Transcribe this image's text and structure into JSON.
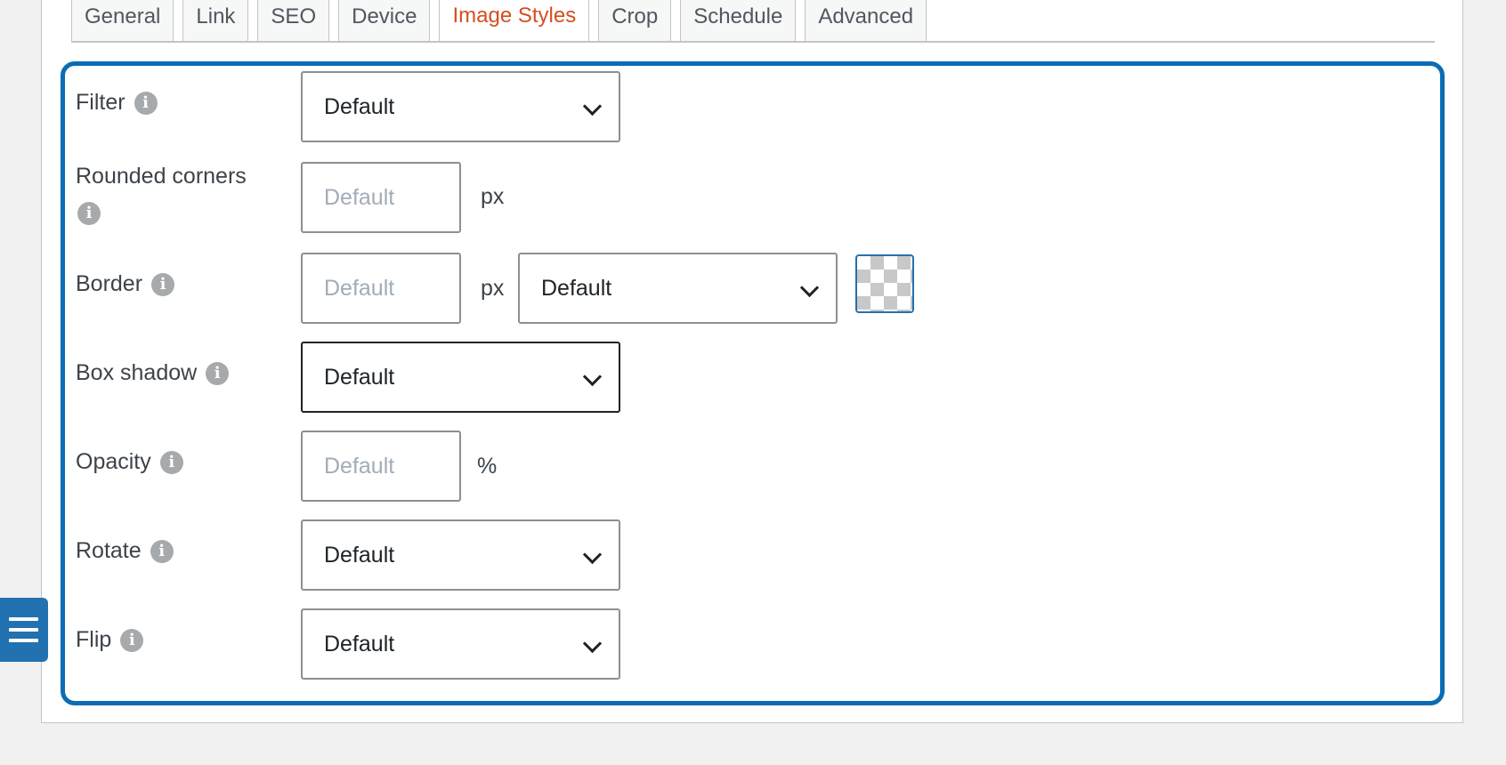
{
  "tabs": [
    {
      "label": "General"
    },
    {
      "label": "Link"
    },
    {
      "label": "SEO"
    },
    {
      "label": "Device"
    },
    {
      "label": "Image Styles",
      "active": true
    },
    {
      "label": "Crop"
    },
    {
      "label": "Schedule"
    },
    {
      "label": "Advanced"
    }
  ],
  "colors": {
    "active_tab": "#d54e21",
    "focus_border": "#0a6cb5",
    "side_button": "#2271b1"
  },
  "form": {
    "filter": {
      "label": "Filter",
      "value": "Default"
    },
    "rounded_corners": {
      "label": "Rounded corners",
      "placeholder": "Default",
      "unit": "px"
    },
    "border": {
      "label": "Border",
      "placeholder": "Default",
      "unit": "px",
      "style_value": "Default",
      "color_icon": "transparent-checkerboard-swatch"
    },
    "box_shadow": {
      "label": "Box shadow",
      "value": "Default"
    },
    "opacity": {
      "label": "Opacity",
      "placeholder": "Default",
      "unit": "%"
    },
    "rotate": {
      "label": "Rotate",
      "value": "Default"
    },
    "flip": {
      "label": "Flip",
      "value": "Default"
    }
  },
  "icons": {
    "info": "info-icon",
    "chevron": "chevron-down-icon",
    "sidebar_toggle": "hamburger-menu-icon"
  }
}
